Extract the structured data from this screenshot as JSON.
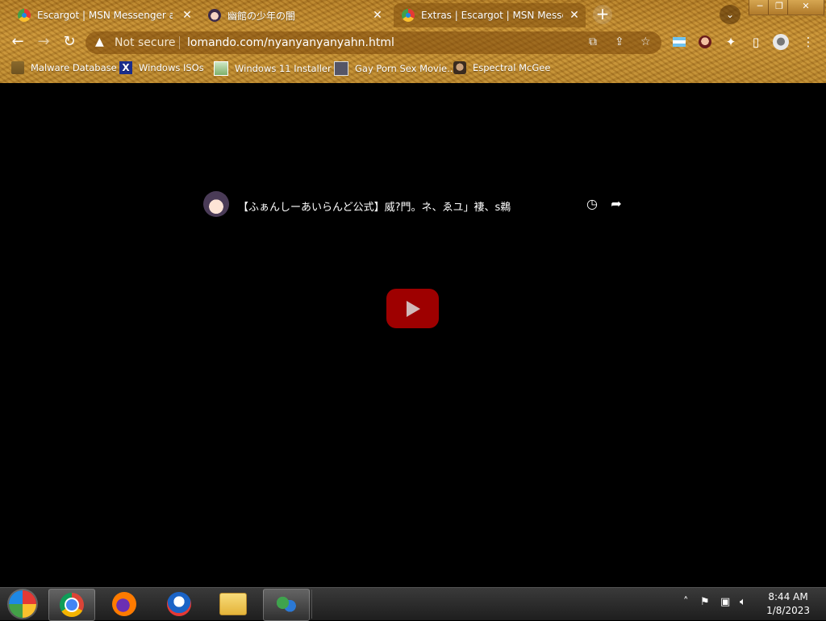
{
  "tabs": [
    {
      "title": "Escargot | MSN Messenger and W",
      "favicon": "escargot-icon",
      "active": false
    },
    {
      "title": "幽館の少年の闇",
      "favicon": "anime-avatar-icon",
      "active": false
    },
    {
      "title": "Extras | Escargot | MSN Messen",
      "favicon": "escargot-icon",
      "active": true
    }
  ],
  "window_controls": {
    "minimize": "─",
    "restore": "❐",
    "close": "✕"
  },
  "toolbar": {
    "back": "←",
    "forward": "→",
    "reload": "↻",
    "security_label": "Not secure",
    "url": "lomando.com/nyanyanyanyahn.html"
  },
  "bookmarks": [
    {
      "label": "Malware Database",
      "icon": "folder-icon"
    },
    {
      "label": "Windows ISOs",
      "icon": "x-icon"
    },
    {
      "label": "Windows 11 Installer",
      "icon": "image-icon"
    },
    {
      "label": "Gay Porn Sex Movie...",
      "icon": "floppy-icon"
    },
    {
      "label": "Espectral McGee",
      "icon": "avatar-icon"
    }
  ],
  "video": {
    "title": "【ふぁんしーあいらんど公式】威?門。ネ、ゑユ」褄、s鵜",
    "watch_later": "◷",
    "share": "➦"
  },
  "taskbar": {
    "time": "8:44 AM",
    "date": "1/8/2023",
    "apps": [
      "start-orb-icon",
      "chrome-icon",
      "firefox-icon",
      "obama-icon",
      "file-explorer-icon",
      "msn-messenger-icon"
    ]
  },
  "colors": {
    "theme": "#b98530",
    "play_button": "#b00000"
  }
}
